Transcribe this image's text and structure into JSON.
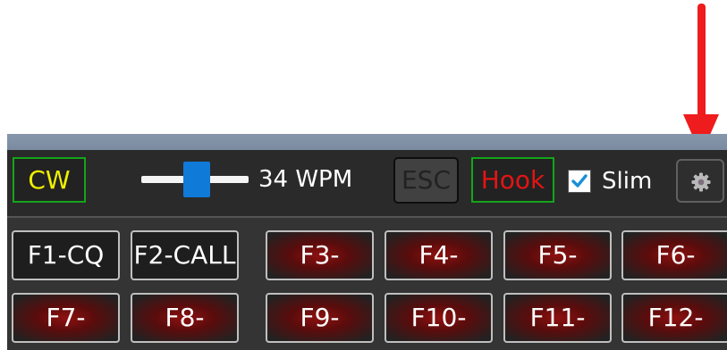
{
  "toolbar": {
    "mode_label": "CW",
    "speed": {
      "value_label": "34 WPM",
      "slider_level_fraction": 0.52
    },
    "esc_label": "ESC",
    "hook_label": "Hook",
    "slim": {
      "label": "Slim",
      "checked": true
    }
  },
  "function_keys": {
    "row1": [
      "F1-CQ",
      "F2-CALL",
      "F3-",
      "F4-",
      "F5-",
      "F6-"
    ],
    "row2": [
      "F7-",
      "F8-",
      "F9-",
      "F10-",
      "F11-",
      "F12-"
    ]
  },
  "colors": {
    "annotation_arrow": "#ee1c1c",
    "mode_text": "#f0f000",
    "hook_text": "#e31414",
    "active_border": "#13a51a",
    "slider_thumb": "#0f7ad8"
  },
  "icons": {
    "settings": "gear-icon",
    "checkbox": "checkmark-icon",
    "annotation": "red-arrow-down"
  }
}
